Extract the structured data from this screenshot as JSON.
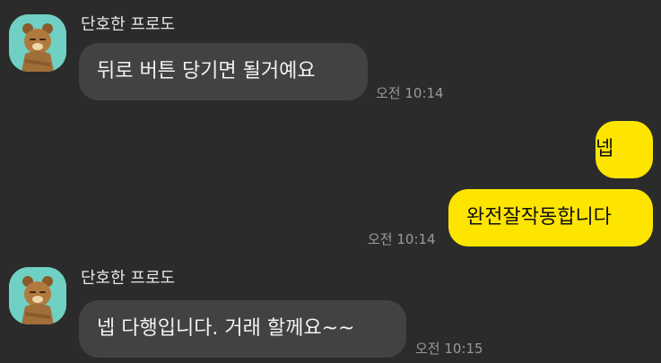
{
  "chat": {
    "messages": [
      {
        "sender": "단호한 프로도",
        "text": "뒤로 버튼 당기면 될거예요",
        "time": "오전 10:14",
        "direction": "incoming"
      },
      {
        "text": "넵",
        "direction": "outgoing"
      },
      {
        "text": "완전잘작동합니다",
        "time": "오전 10:14",
        "direction": "outgoing"
      },
      {
        "sender": "단호한 프로도",
        "text": "넵 다행입니다. 거래 할께요~~",
        "time": "오전 10:15",
        "direction": "incoming"
      }
    ]
  },
  "colors": {
    "background": "#2b2b2b",
    "incoming_bubble": "#424242",
    "outgoing_bubble": "#fee500",
    "avatar_background": "#6fd0c3",
    "timestamp": "#9a9a9a"
  },
  "icons": {
    "avatar": "bear-character-avatar-icon"
  }
}
